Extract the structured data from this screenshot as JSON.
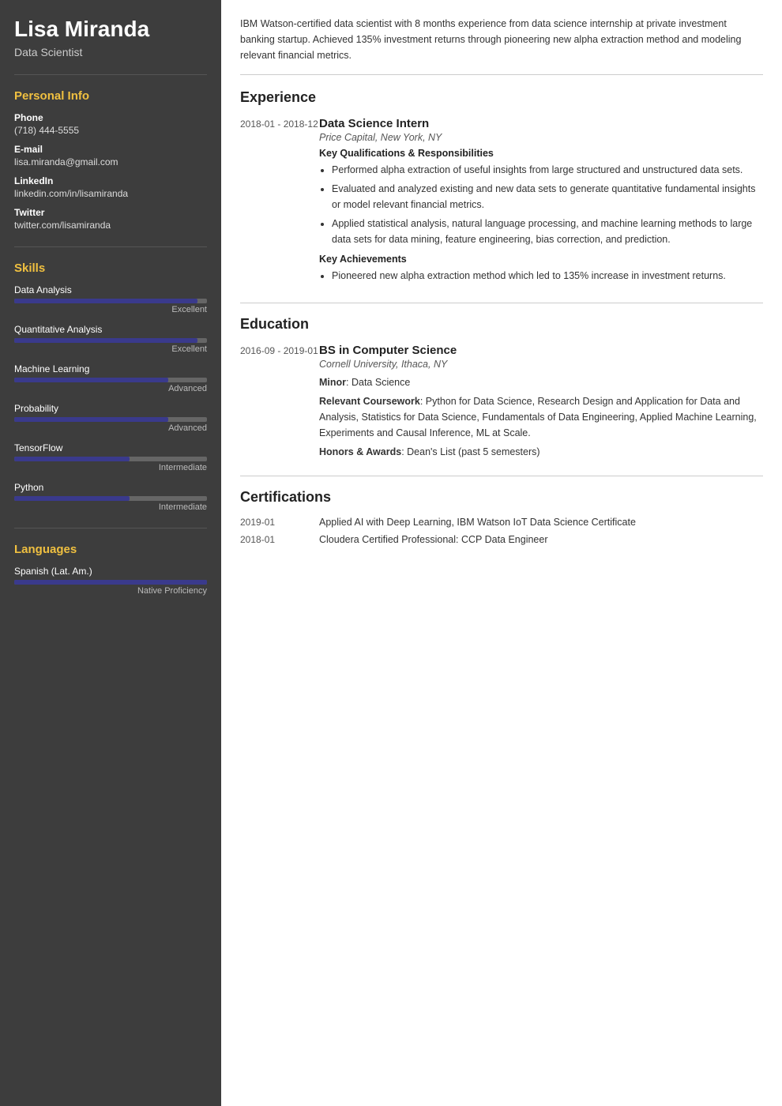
{
  "sidebar": {
    "name": "Lisa Miranda",
    "title": "Data Scientist",
    "personal_info": {
      "section_title": "Personal Info",
      "phone_label": "Phone",
      "phone_value": "(718) 444-5555",
      "email_label": "E-mail",
      "email_value": "lisa.miranda@gmail.com",
      "linkedin_label": "LinkedIn",
      "linkedin_value": "linkedin.com/in/lisamiranda",
      "twitter_label": "Twitter",
      "twitter_value": "twitter.com/lisamiranda"
    },
    "skills": {
      "section_title": "Skills",
      "items": [
        {
          "name": "Data Analysis",
          "level": "Excellent",
          "pct": 95
        },
        {
          "name": "Quantitative Analysis",
          "level": "Excellent",
          "pct": 95
        },
        {
          "name": "Machine Learning",
          "level": "Advanced",
          "pct": 80
        },
        {
          "name": "Probability",
          "level": "Advanced",
          "pct": 80
        },
        {
          "name": "TensorFlow",
          "level": "Intermediate",
          "pct": 60
        },
        {
          "name": "Python",
          "level": "Intermediate",
          "pct": 60
        }
      ]
    },
    "languages": {
      "section_title": "Languages",
      "items": [
        {
          "name": "Spanish (Lat. Am.)",
          "level": "Native Proficiency",
          "pct": 100
        }
      ]
    }
  },
  "main": {
    "summary": "IBM Watson-certified data scientist with 8 months experience from data science internship at private investment banking startup. Achieved 135% investment returns through pioneering new alpha extraction method and modeling relevant financial metrics.",
    "experience": {
      "section_title": "Experience",
      "entries": [
        {
          "date": "2018-01 - 2018-12",
          "job_title": "Data Science Intern",
          "company": "Price Capital, New York, NY",
          "qualifications_title": "Key Qualifications & Responsibilities",
          "bullets": [
            "Performed alpha extraction of useful insights from large structured and unstructured data sets.",
            "Evaluated and analyzed existing and new data sets to generate quantitative fundamental insights or model relevant financial metrics.",
            "Applied statistical analysis, natural language processing, and machine learning methods to large data sets for data mining, feature engineering, bias correction, and prediction."
          ],
          "achievements_title": "Key Achievements",
          "achievement_bullets": [
            "Pioneered new alpha extraction method which led to 135% increase in investment returns."
          ]
        }
      ]
    },
    "education": {
      "section_title": "Education",
      "entries": [
        {
          "date": "2016-09 - 2019-01",
          "degree": "BS in Computer Science",
          "institution": "Cornell University, Ithaca, NY",
          "minor_label": "Minor",
          "minor_value": "Data Science",
          "coursework_label": "Relevant Coursework",
          "coursework_value": "Python for Data Science, Research Design and Application for Data and Analysis, Statistics for Data Science, Fundamentals of Data Engineering, Applied Machine Learning, Experiments and Causal Inference, ML at Scale.",
          "honors_label": "Honors & Awards",
          "honors_value": "Dean's List (past 5 semesters)"
        }
      ]
    },
    "certifications": {
      "section_title": "Certifications",
      "entries": [
        {
          "date": "2019-01",
          "text": "Applied AI with Deep Learning, IBM Watson IoT Data Science Certificate"
        },
        {
          "date": "2018-01",
          "text": "Cloudera Certified Professional: CCP Data Engineer"
        }
      ]
    }
  }
}
